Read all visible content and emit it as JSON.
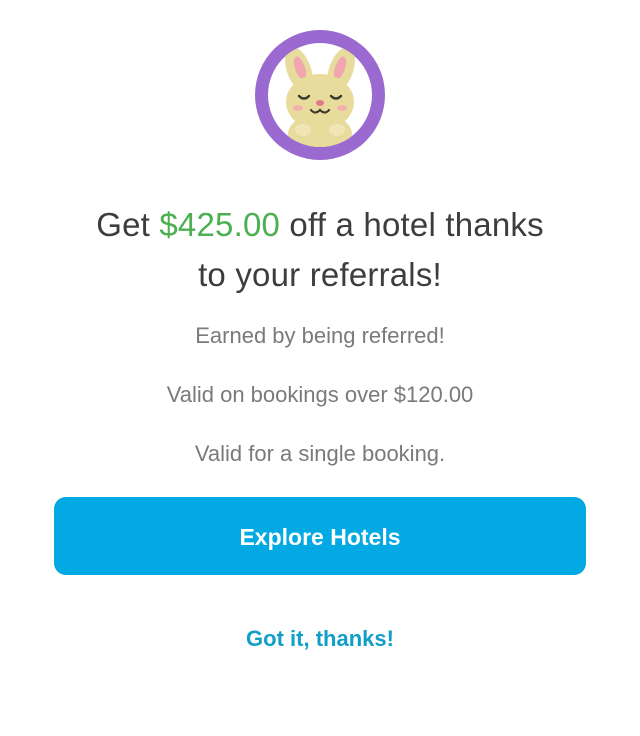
{
  "avatar": {
    "icon": "bunny-mascot-icon",
    "colors": {
      "ring": "#9a6ad0",
      "inner": "#ffffff",
      "bunny": "#e8dc9c",
      "cheeks": "#f2a7b0",
      "ears_inner": "#f2a7b0",
      "bowl": "#f7c344"
    }
  },
  "headline": {
    "prefix": "Get ",
    "amount": "$425.00",
    "suffix_line1": " off a hotel thanks",
    "line2": "to your referrals!"
  },
  "details": [
    "Earned by being referred!",
    "Valid on bookings over $120.00",
    "Valid for a single booking."
  ],
  "actions": {
    "primary_label": "Explore Hotels",
    "secondary_label": "Got it, thanks!"
  },
  "colors": {
    "accent_green": "#4caf50",
    "button_blue": "#02a9e3",
    "link_blue": "#119fc7"
  }
}
